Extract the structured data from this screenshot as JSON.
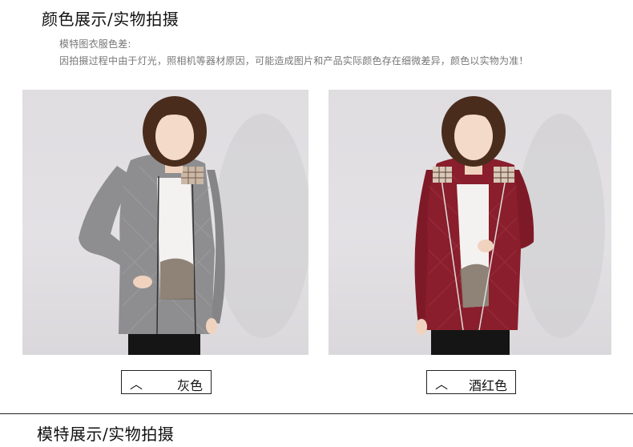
{
  "section1": {
    "title": "颜色展示/实物拍摄",
    "note_line1": "模特图衣服色差:",
    "note_line2": "因拍摄过程中由于灯光，照相机等器材原因，可能造成图片和产品实际颜色存在细微差异，颜色以实物为准！"
  },
  "colors": [
    {
      "caret": "︿",
      "label": "灰色",
      "jacket_color": "#8e8e90"
    },
    {
      "caret": "︿",
      "label": "酒红色",
      "jacket_color": "#8a1e2c"
    }
  ],
  "section2": {
    "title": "模特展示/实物拍摄"
  }
}
